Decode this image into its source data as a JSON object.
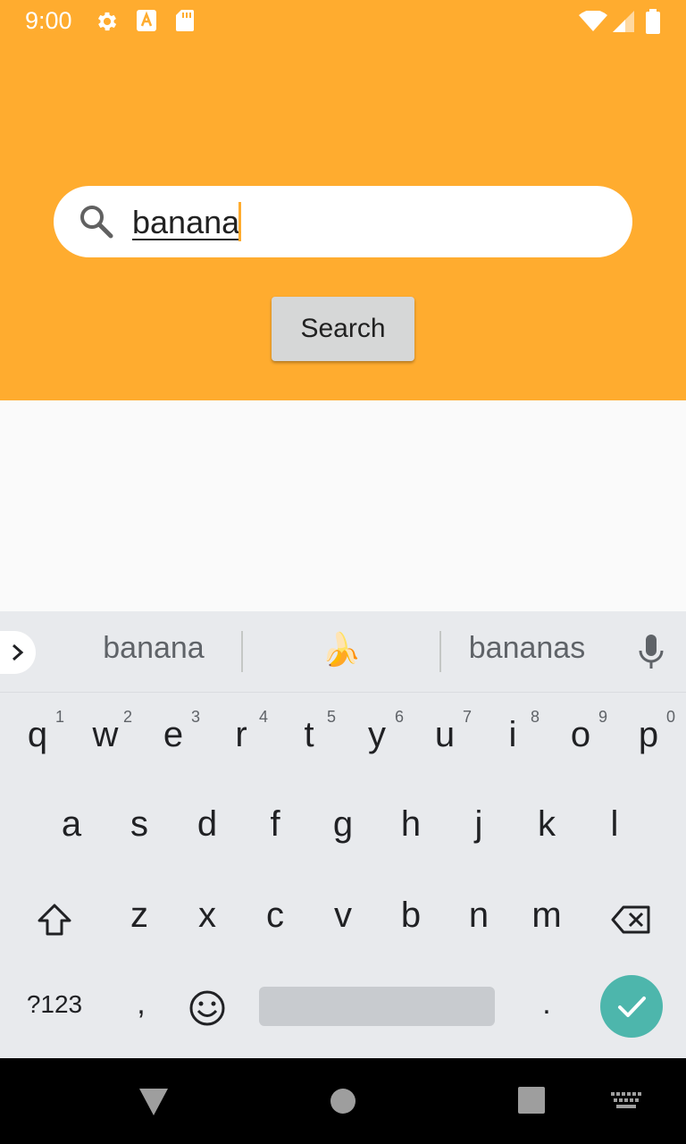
{
  "status_bar": {
    "time": "9:00"
  },
  "search": {
    "value": "banana",
    "button_label": "Search"
  },
  "suggestions": {
    "left": "banana",
    "middle_emoji": "🍌",
    "right": "bananas"
  },
  "keyboard": {
    "row1": [
      {
        "k": "q",
        "h": "1"
      },
      {
        "k": "w",
        "h": "2"
      },
      {
        "k": "e",
        "h": "3"
      },
      {
        "k": "r",
        "h": "4"
      },
      {
        "k": "t",
        "h": "5"
      },
      {
        "k": "y",
        "h": "6"
      },
      {
        "k": "u",
        "h": "7"
      },
      {
        "k": "i",
        "h": "8"
      },
      {
        "k": "o",
        "h": "9"
      },
      {
        "k": "p",
        "h": "0"
      }
    ],
    "row2": [
      "a",
      "s",
      "d",
      "f",
      "g",
      "h",
      "j",
      "k",
      "l"
    ],
    "row3": [
      "z",
      "x",
      "c",
      "v",
      "b",
      "n",
      "m"
    ],
    "symbols_label": "?123",
    "comma": ",",
    "period": "."
  },
  "colors": {
    "header": "#FFAC2F",
    "accent": "#4DB6AC",
    "keyboard_bg": "#E8EAED"
  }
}
